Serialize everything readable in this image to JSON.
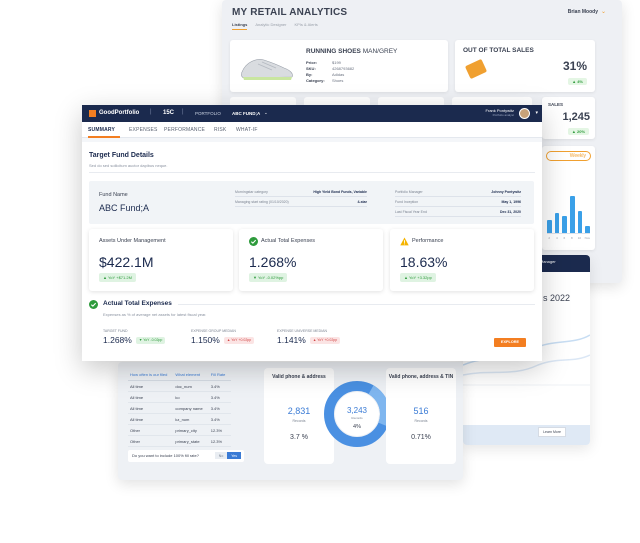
{
  "retail": {
    "title": "MY RETAIL ANALYTICS",
    "user": "Brian Moody",
    "tabs": [
      "Listings",
      "Analytic Designer",
      "KPIs & Alerts"
    ],
    "product": {
      "name": "RUNNING SHOES",
      "variant": "MAN/GREY",
      "specs": [
        {
          "k": "Price:",
          "v": "$199"
        },
        {
          "k": "SKU:",
          "v": "4268793682"
        },
        {
          "k": "By:",
          "v": "Adidas"
        },
        {
          "k": "Category:",
          "v": "Shoes"
        }
      ]
    },
    "out_of_total": {
      "title": "OUT OF TOTAL SALES",
      "value": "31%",
      "delta": "▲ 4%"
    },
    "sales": {
      "title": "SALES",
      "value": "1,245",
      "delta": "▲ 20%"
    },
    "period": "Weekly",
    "weekly_bars": [
      0.35,
      0.55,
      0.45,
      1.0,
      0.6,
      0.2
    ],
    "weekly_labels": [
      "2",
      "4",
      "6",
      "8",
      "10",
      "Nov"
    ]
  },
  "dq": {
    "headers": [
      "How often is our filed",
      "What element",
      "Fill Rate"
    ],
    "rows": [
      [
        "All time",
        "doc_num",
        "3.4%"
      ],
      [
        "All time",
        "ko",
        "3.4%"
      ],
      [
        "All time",
        "company name",
        "3.4%"
      ],
      [
        "All time",
        "kz_num",
        "3.4%"
      ],
      [
        "Other",
        "primary_city",
        "12.3%"
      ],
      [
        "Other",
        "primary_state",
        "12.3%"
      ]
    ],
    "question": "Do you want to include 100% fill rate?",
    "no": "No",
    "yes": "Yes",
    "left": {
      "title": "Valid phone & address",
      "value": "2,831",
      "sub": "Records",
      "pct": "3.7 %"
    },
    "center": {
      "value": "3,243",
      "sub": "Records",
      "pct": "4%"
    },
    "right": {
      "title": "Valid phone, address & TIN",
      "value": "516",
      "sub": "Records",
      "pct": "0.71%"
    }
  },
  "linepanel": {
    "manager": "Acct Manager",
    "year": "s 2022",
    "learn": "Learn More"
  },
  "app": {
    "brand": "GoodPortfolio",
    "code": "15C",
    "crumb1": "PORTFOLIO",
    "crumb2": "ABC FUND;A",
    "user_name": "Frank Pontywitz",
    "user_role": "Portfolio analyst"
  },
  "tabs": [
    "SUMMARY",
    "EXPENSES",
    "PERFORMANCE",
    "RISK",
    "WHAT-IF"
  ],
  "details": {
    "title": "Target Fund Details",
    "subtitle": "Sed do sed sollicitum auctor dapibus neque.",
    "fund_label": "Fund Name",
    "fund_name": "ABC Fund;A",
    "attrs_mid": [
      {
        "k": "Morningstar category",
        "v": "High Yield Bond Funds, Variable"
      },
      {
        "k": "Managing start rating (01/10/2020)",
        "v": "4-star"
      }
    ],
    "attrs_right": [
      {
        "k": "Portfolio Manager",
        "v": "Johnny Pontywitz"
      },
      {
        "k": "Fund Inception",
        "v": "May 1, 1996"
      },
      {
        "k": "Last Fiscal Year End",
        "v": "Dec 31, 2020"
      }
    ]
  },
  "kpis": [
    {
      "label": "Assets Under Management",
      "value": "$422.1M",
      "delta": "▲ YoY +$71.2M",
      "tone": "g"
    },
    {
      "label": "Actual Total Expenses",
      "value": "1.268%",
      "delta": "▼ YoY -0.02%pp",
      "tone": "g"
    },
    {
      "label": "Performance",
      "value": "18.63%",
      "delta": "▲ YoY +3.32pp",
      "tone": "g"
    }
  ],
  "expenses": {
    "title": "Actual Total Expenses",
    "subtitle": "Expenses as % of average net assets for latest fiscal year.",
    "items": [
      {
        "label": "TARGET FUND",
        "value": "1.268%",
        "delta": "▼ YoY -0.02pp",
        "tone": "g"
      },
      {
        "label": "EXPENSE GROUP MEDIAN",
        "value": "1.150%",
        "delta": "▲ YoY +0.02pp",
        "tone": "r"
      },
      {
        "label": "EXPENSE UNIVERSE MEDIAN",
        "value": "1.141%",
        "delta": "▲ YoY +0.02pp",
        "tone": "r"
      }
    ],
    "explore": "EXPLORE"
  },
  "colors": {
    "navy": "#1b2a4e",
    "orange": "#f37e21",
    "blue": "#3a7bd5",
    "green": "#2e9b3c",
    "red": "#d24545"
  }
}
